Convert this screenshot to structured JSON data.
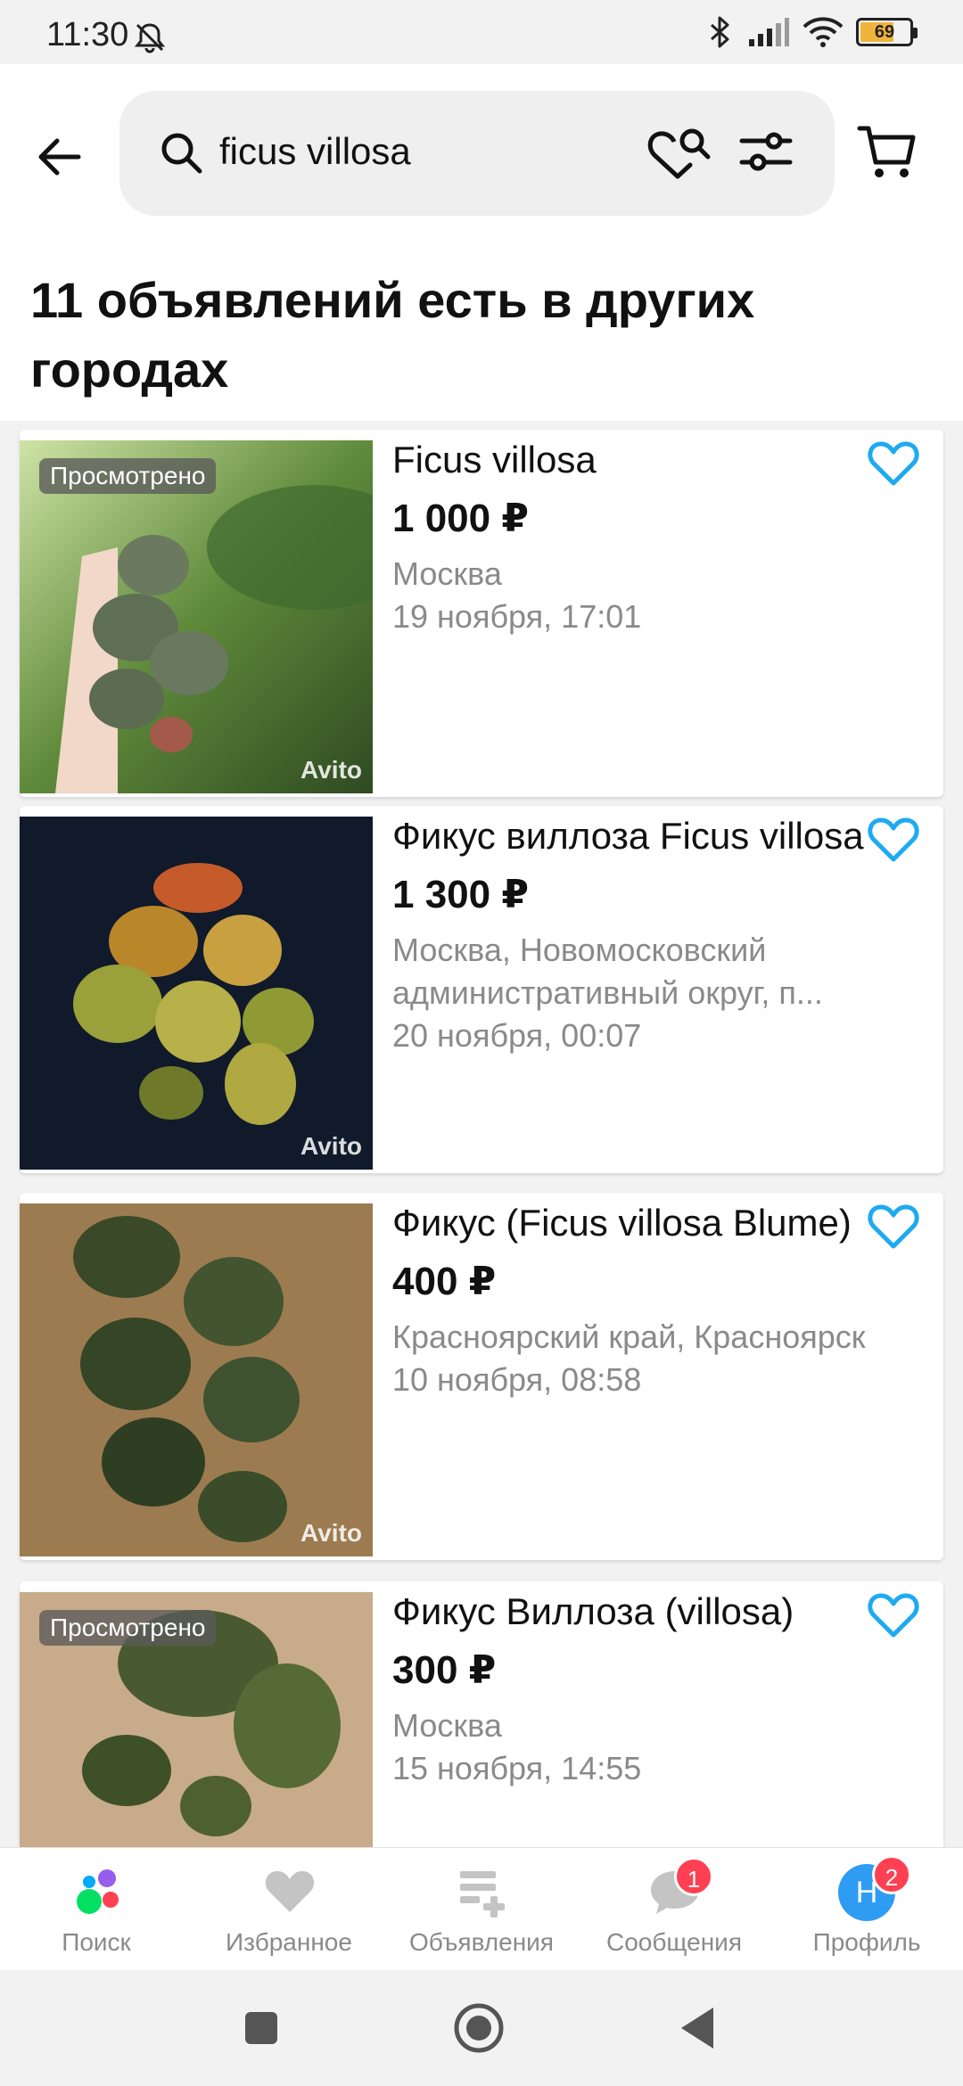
{
  "status_bar": {
    "time": "11:30",
    "battery": "69",
    "battery_level": 0.69
  },
  "top_bar": {
    "search_query": "ficus villosa",
    "icons": [
      "back-arrow-icon",
      "search-icon",
      "saved-search-heart-icon",
      "filter-sliders-icon",
      "cart-icon"
    ]
  },
  "heading": "11 объявлений есть в других городах",
  "listings": [
    {
      "title": "Ficus villosa",
      "price": "1 000 ₽",
      "location": "Москва",
      "date": "19 ноября, 17:01",
      "badge": "Просмотрено",
      "watermark": "Avito"
    },
    {
      "title": "Фикус виллоза Ficus villosa",
      "price": "1 300 ₽",
      "location": "Москва, Новомосковский административный округ, п...",
      "date": "20 ноября, 00:07",
      "badge": "",
      "watermark": "Avito"
    },
    {
      "title": "Фикус (Ficus villosa Blume)",
      "price": "400 ₽",
      "location": "Красноярский край, Красноярск",
      "date": "10 ноября, 08:58",
      "badge": "",
      "watermark": "Avito"
    },
    {
      "title": "Фикус Виллоза (villosa)",
      "price": "300 ₽",
      "location": "Москва",
      "date": "15 ноября, 14:55",
      "badge": "Просмотрено",
      "watermark": ""
    }
  ],
  "bottom_nav": {
    "items": [
      {
        "label": "Поиск",
        "icon": "search-dots-icon"
      },
      {
        "label": "Избранное",
        "icon": "heart-icon"
      },
      {
        "label": "Объявления",
        "icon": "add-listing-icon"
      },
      {
        "label": "Сообщения",
        "icon": "chat-icon",
        "badge": "1"
      },
      {
        "label": "Профиль",
        "icon": "avatar-icon",
        "badge": "2",
        "avatar_letter": "Н"
      }
    ]
  },
  "colors": {
    "heart_accent": "#1eaaf1",
    "badge_red": "#ff4053",
    "avatar_blue": "#2f9cf3"
  }
}
